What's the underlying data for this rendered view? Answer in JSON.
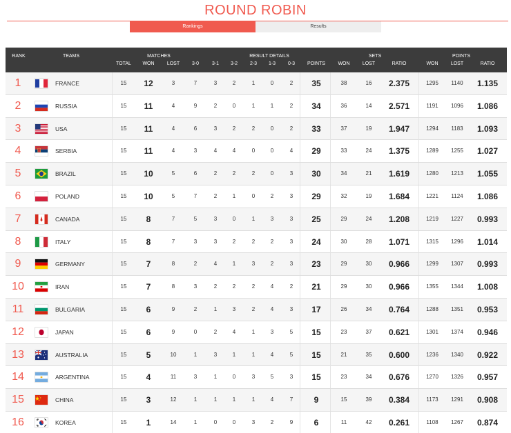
{
  "page_title": "ROUND ROBIN",
  "tabs": [
    {
      "label": "Rankings",
      "active": true
    },
    {
      "label": "Results",
      "active": false
    }
  ],
  "header": {
    "rank": "RANK",
    "teams": "TEAMS",
    "matches": "MATCHES",
    "result_details": "RESULT DETAILS",
    "sets": "SETS",
    "points": "POINTS",
    "total": "TOTAL",
    "won": "WON",
    "lost": "LOST",
    "r30": "3-0",
    "r31": "3-1",
    "r32": "3-2",
    "r23": "2-3",
    "r13": "1-3",
    "r03": "0-3",
    "points_col": "POINTS",
    "sets_won": "WON",
    "sets_lost": "LOST",
    "sets_ratio": "RATIO",
    "pts_won": "WON",
    "pts_lost": "LOST",
    "pts_ratio": "RATIO"
  },
  "colors": {
    "accent": "#f05a4f",
    "header_bg": "#3c3c3c"
  },
  "rows": [
    {
      "rank": "1",
      "team": "FRANCE",
      "flag": "flag-france",
      "total": "15",
      "won": "12",
      "lost": "3",
      "r30": "7",
      "r31": "3",
      "r32": "2",
      "r23": "1",
      "r13": "0",
      "r03": "2",
      "points": "35",
      "sw": "38",
      "sl": "16",
      "sr": "2.375",
      "pw": "1295",
      "pl": "1140",
      "pr": "1.135"
    },
    {
      "rank": "2",
      "team": "RUSSIA",
      "flag": "flag-russia",
      "total": "15",
      "won": "11",
      "lost": "4",
      "r30": "9",
      "r31": "2",
      "r32": "0",
      "r23": "1",
      "r13": "1",
      "r03": "2",
      "points": "34",
      "sw": "36",
      "sl": "14",
      "sr": "2.571",
      "pw": "1191",
      "pl": "1096",
      "pr": "1.086"
    },
    {
      "rank": "3",
      "team": "USA",
      "flag": "flag-usa",
      "total": "15",
      "won": "11",
      "lost": "4",
      "r30": "6",
      "r31": "3",
      "r32": "2",
      "r23": "2",
      "r13": "0",
      "r03": "2",
      "points": "33",
      "sw": "37",
      "sl": "19",
      "sr": "1.947",
      "pw": "1294",
      "pl": "1183",
      "pr": "1.093"
    },
    {
      "rank": "4",
      "team": "SERBIA",
      "flag": "flag-serbia",
      "total": "15",
      "won": "11",
      "lost": "4",
      "r30": "3",
      "r31": "4",
      "r32": "4",
      "r23": "0",
      "r13": "0",
      "r03": "4",
      "points": "29",
      "sw": "33",
      "sl": "24",
      "sr": "1.375",
      "pw": "1289",
      "pl": "1255",
      "pr": "1.027"
    },
    {
      "rank": "5",
      "team": "BRAZIL",
      "flag": "flag-brazil",
      "total": "15",
      "won": "10",
      "lost": "5",
      "r30": "6",
      "r31": "2",
      "r32": "2",
      "r23": "2",
      "r13": "0",
      "r03": "3",
      "points": "30",
      "sw": "34",
      "sl": "21",
      "sr": "1.619",
      "pw": "1280",
      "pl": "1213",
      "pr": "1.055"
    },
    {
      "rank": "6",
      "team": "POLAND",
      "flag": "flag-poland",
      "total": "15",
      "won": "10",
      "lost": "5",
      "r30": "7",
      "r31": "2",
      "r32": "1",
      "r23": "0",
      "r13": "2",
      "r03": "3",
      "points": "29",
      "sw": "32",
      "sl": "19",
      "sr": "1.684",
      "pw": "1221",
      "pl": "1124",
      "pr": "1.086"
    },
    {
      "rank": "7",
      "team": "CANADA",
      "flag": "flag-canada",
      "total": "15",
      "won": "8",
      "lost": "7",
      "r30": "5",
      "r31": "3",
      "r32": "0",
      "r23": "1",
      "r13": "3",
      "r03": "3",
      "points": "25",
      "sw": "29",
      "sl": "24",
      "sr": "1.208",
      "pw": "1219",
      "pl": "1227",
      "pr": "0.993"
    },
    {
      "rank": "8",
      "team": "ITALY",
      "flag": "flag-italy",
      "total": "15",
      "won": "8",
      "lost": "7",
      "r30": "3",
      "r31": "3",
      "r32": "2",
      "r23": "2",
      "r13": "2",
      "r03": "3",
      "points": "24",
      "sw": "30",
      "sl": "28",
      "sr": "1.071",
      "pw": "1315",
      "pl": "1296",
      "pr": "1.014"
    },
    {
      "rank": "9",
      "team": "GERMANY",
      "flag": "flag-germany",
      "total": "15",
      "won": "7",
      "lost": "8",
      "r30": "2",
      "r31": "4",
      "r32": "1",
      "r23": "3",
      "r13": "2",
      "r03": "3",
      "points": "23",
      "sw": "29",
      "sl": "30",
      "sr": "0.966",
      "pw": "1299",
      "pl": "1307",
      "pr": "0.993"
    },
    {
      "rank": "10",
      "team": "IRAN",
      "flag": "flag-iran",
      "total": "15",
      "won": "7",
      "lost": "8",
      "r30": "3",
      "r31": "2",
      "r32": "2",
      "r23": "2",
      "r13": "4",
      "r03": "2",
      "points": "21",
      "sw": "29",
      "sl": "30",
      "sr": "0.966",
      "pw": "1355",
      "pl": "1344",
      "pr": "1.008"
    },
    {
      "rank": "11",
      "team": "BULGARIA",
      "flag": "flag-bulgaria",
      "total": "15",
      "won": "6",
      "lost": "9",
      "r30": "2",
      "r31": "1",
      "r32": "3",
      "r23": "2",
      "r13": "4",
      "r03": "3",
      "points": "17",
      "sw": "26",
      "sl": "34",
      "sr": "0.764",
      "pw": "1288",
      "pl": "1351",
      "pr": "0.953"
    },
    {
      "rank": "12",
      "team": "JAPAN",
      "flag": "flag-japan",
      "total": "15",
      "won": "6",
      "lost": "9",
      "r30": "0",
      "r31": "2",
      "r32": "4",
      "r23": "1",
      "r13": "3",
      "r03": "5",
      "points": "15",
      "sw": "23",
      "sl": "37",
      "sr": "0.621",
      "pw": "1301",
      "pl": "1374",
      "pr": "0.946"
    },
    {
      "rank": "13",
      "team": "AUSTRALIA",
      "flag": "flag-australia",
      "total": "15",
      "won": "5",
      "lost": "10",
      "r30": "1",
      "r31": "3",
      "r32": "1",
      "r23": "1",
      "r13": "4",
      "r03": "5",
      "points": "15",
      "sw": "21",
      "sl": "35",
      "sr": "0.600",
      "pw": "1236",
      "pl": "1340",
      "pr": "0.922"
    },
    {
      "rank": "14",
      "team": "ARGENTINA",
      "flag": "flag-argentina",
      "total": "15",
      "won": "4",
      "lost": "11",
      "r30": "3",
      "r31": "1",
      "r32": "0",
      "r23": "3",
      "r13": "5",
      "r03": "3",
      "points": "15",
      "sw": "23",
      "sl": "34",
      "sr": "0.676",
      "pw": "1270",
      "pl": "1326",
      "pr": "0.957"
    },
    {
      "rank": "15",
      "team": "CHINA",
      "flag": "flag-china",
      "total": "15",
      "won": "3",
      "lost": "12",
      "r30": "1",
      "r31": "1",
      "r32": "1",
      "r23": "1",
      "r13": "4",
      "r03": "7",
      "points": "9",
      "sw": "15",
      "sl": "39",
      "sr": "0.384",
      "pw": "1173",
      "pl": "1291",
      "pr": "0.908"
    },
    {
      "rank": "16",
      "team": "KOREA",
      "flag": "flag-korea",
      "total": "15",
      "won": "1",
      "lost": "14",
      "r30": "1",
      "r31": "0",
      "r32": "0",
      "r23": "3",
      "r13": "2",
      "r03": "9",
      "points": "6",
      "sw": "11",
      "sl": "42",
      "sr": "0.261",
      "pw": "1108",
      "pl": "1267",
      "pr": "0.874"
    }
  ]
}
